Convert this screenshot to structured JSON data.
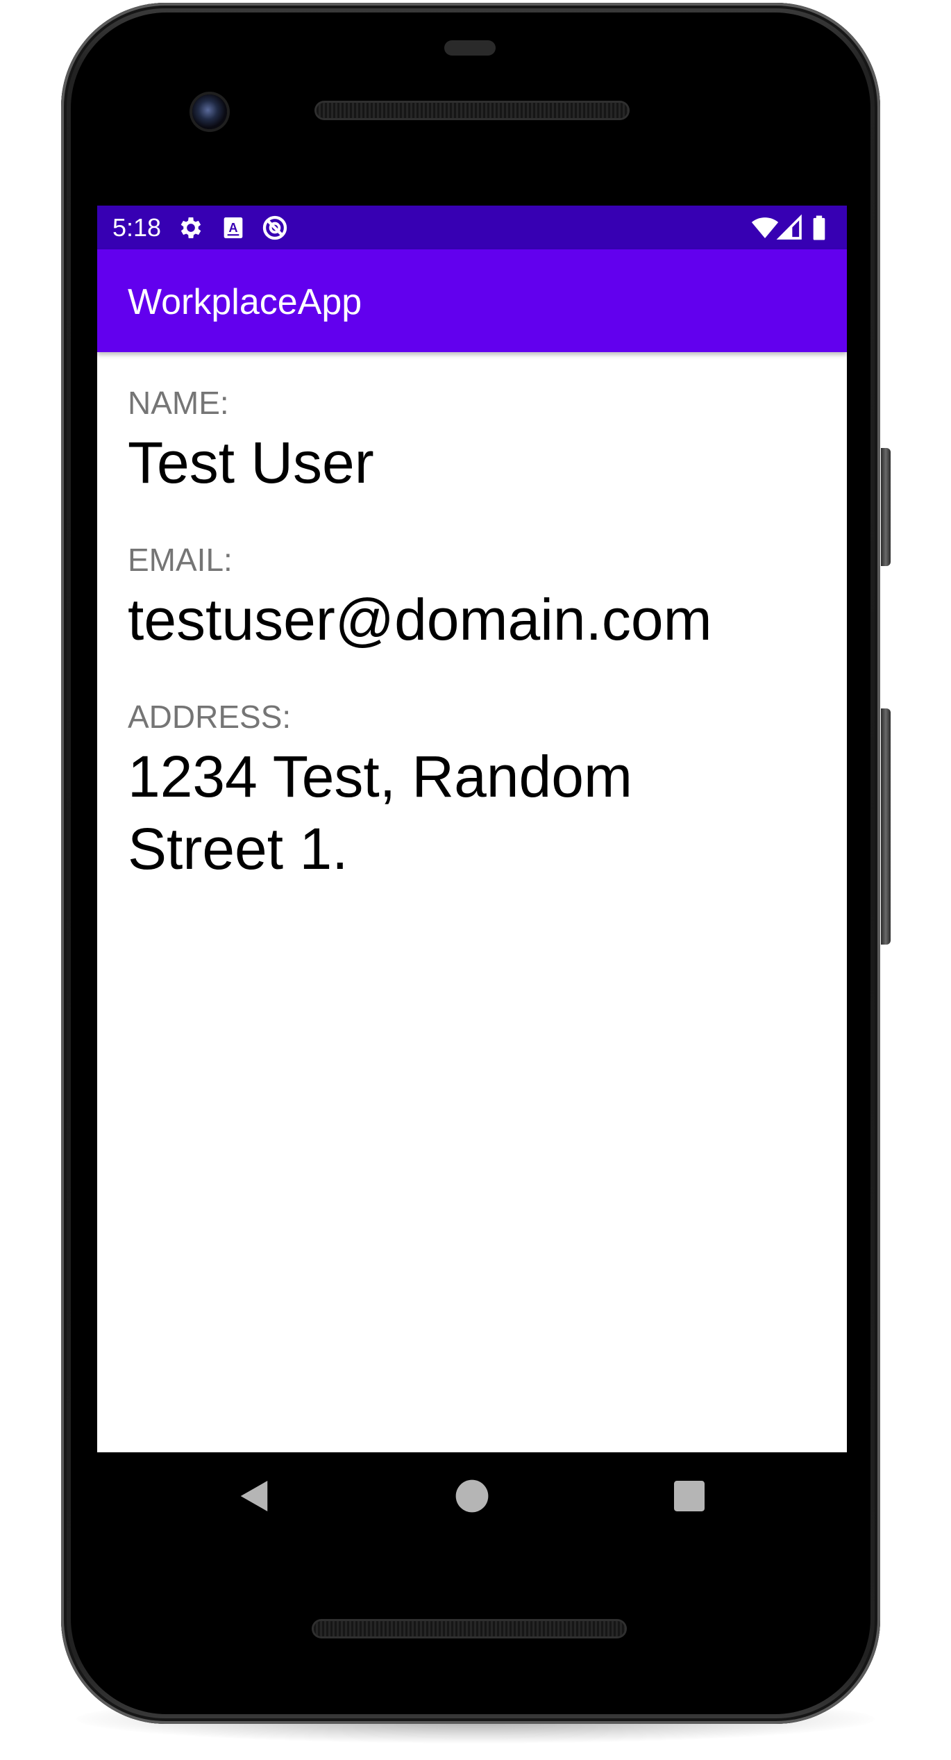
{
  "status_bar": {
    "time": "5:18",
    "left_icons": [
      "gear-icon",
      "keyboard-a-icon",
      "do-not-disturb-icon"
    ],
    "right_icons": [
      "wifi-icon",
      "cell-signal-icon",
      "battery-icon"
    ],
    "background": "#3700b3"
  },
  "app_bar": {
    "title": "WorkplaceApp",
    "background": "#6200ee"
  },
  "profile": {
    "name_label": "NAME:",
    "name_value": "Test User",
    "email_label": "EMAIL:",
    "email_value": "testuser@domain.com",
    "address_label": "ADDRESS:",
    "address_line1": "1234 Test, Random",
    "address_line2": "Street 1."
  },
  "nav_bar": {
    "buttons": [
      "back-icon",
      "home-icon",
      "recents-icon"
    ]
  },
  "colors": {
    "label": "#757575",
    "value": "#000000"
  }
}
